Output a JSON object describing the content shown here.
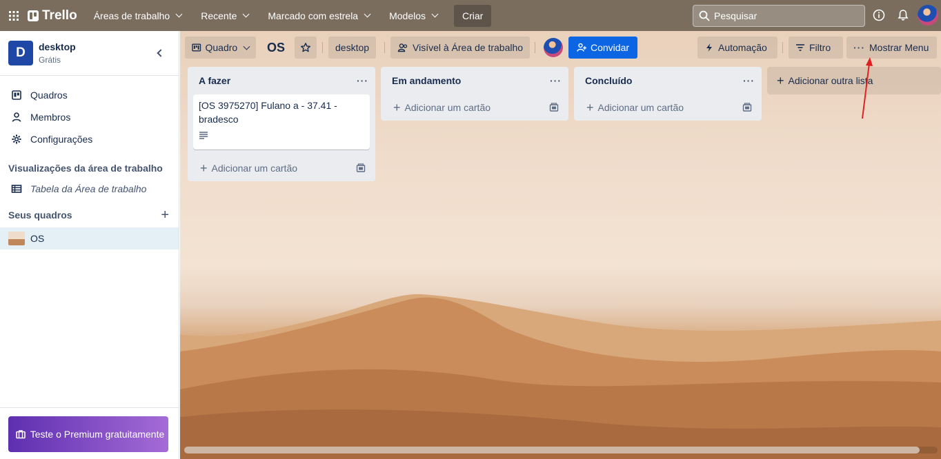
{
  "topnav": {
    "app_name": "Trello",
    "items": [
      "Áreas de trabalho",
      "Recente",
      "Marcado com estrela",
      "Modelos"
    ],
    "create_label": "Criar",
    "search_placeholder": "Pesquisar"
  },
  "sidebar": {
    "workspace_initial": "D",
    "workspace_name": "desktop",
    "workspace_plan": "Grátis",
    "nav": [
      "Quadros",
      "Membros",
      "Configurações"
    ],
    "views_title": "Visualizações da área de trabalho",
    "views": [
      "Tabela da Área de trabalho"
    ],
    "boards_title": "Seus quadros",
    "boards": [
      "OS"
    ],
    "premium_label": "Teste o Premium gratuitamente"
  },
  "board": {
    "view_label": "Quadro",
    "title": "OS",
    "workspace_label": "desktop",
    "visibility_label": "Visível à Área de trabalho",
    "invite_label": "Convidar",
    "automation_label": "Automação",
    "filter_label": "Filtro",
    "menu_label": "Mostrar Menu",
    "lists": [
      {
        "title": "A fazer",
        "cards": [
          "[OS 3975270] Fulano a - 37.41 - bradesco"
        ],
        "add_label": "Adicionar um cartão"
      },
      {
        "title": "Em andamento",
        "cards": [],
        "add_label": "Adicionar um cartão"
      },
      {
        "title": "Concluído",
        "cards": [],
        "add_label": "Adicionar um cartão"
      }
    ],
    "add_list_label": "Adicionar outra lista"
  },
  "colors": {
    "nav_bg": "#7b6d5e",
    "invite_bg": "#0c66e4",
    "workspace_badge": "#1f47a6",
    "annotation_arrow": "#e02020"
  }
}
